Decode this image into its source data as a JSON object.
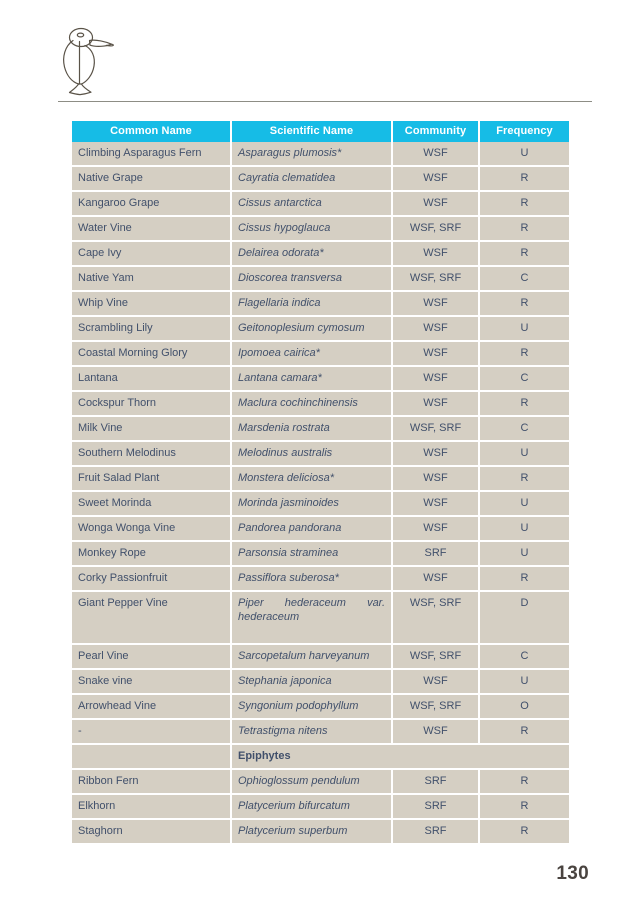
{
  "document": {
    "page_number": "130",
    "logo_name": "bird-logo"
  },
  "table": {
    "columns": [
      {
        "key": "common",
        "label": "Common Name"
      },
      {
        "key": "scientific",
        "label": "Scientific Name"
      },
      {
        "key": "community",
        "label": "Community"
      },
      {
        "key": "frequency",
        "label": "Frequency"
      }
    ],
    "header_bg": "#16bce6",
    "row_bg": "#d5cfc3",
    "group_bg": "#6b6142",
    "text_color": "#41506b",
    "rows": [
      {
        "type": "data",
        "common": "Climbing Asparagus Fern",
        "scientific": "Asparagus plumosis*",
        "community": "WSF",
        "frequency": "U"
      },
      {
        "type": "data",
        "common": "Native Grape",
        "scientific": "Cayratia clematidea",
        "community": "WSF",
        "frequency": "R"
      },
      {
        "type": "data",
        "common": "Kangaroo Grape",
        "scientific": "Cissus antarctica",
        "community": "WSF",
        "frequency": "R"
      },
      {
        "type": "data",
        "common": "Water Vine",
        "scientific": "Cissus hypoglauca",
        "community": "WSF, SRF",
        "frequency": "R"
      },
      {
        "type": "data",
        "common": "Cape Ivy",
        "scientific": "Delairea odorata*",
        "community": "WSF",
        "frequency": "R"
      },
      {
        "type": "data",
        "common": "Native Yam",
        "scientific": "Dioscorea transversa",
        "community": "WSF, SRF",
        "frequency": "C"
      },
      {
        "type": "data",
        "common": "Whip Vine",
        "scientific": "Flagellaria indica",
        "community": "WSF",
        "frequency": "R"
      },
      {
        "type": "data",
        "common": "Scrambling Lily",
        "scientific": "Geitonoplesium cymosum",
        "community": "WSF",
        "frequency": "U"
      },
      {
        "type": "data",
        "common": "Coastal Morning Glory",
        "scientific": "Ipomoea cairica*",
        "community": "WSF",
        "frequency": "R"
      },
      {
        "type": "data",
        "common": "Lantana",
        "scientific": "Lantana camara*",
        "community": "WSF",
        "frequency": "C"
      },
      {
        "type": "data",
        "common": "Cockspur Thorn",
        "scientific": "Maclura cochinchinensis",
        "community": "WSF",
        "frequency": "R"
      },
      {
        "type": "data",
        "common": "Milk Vine",
        "scientific": "Marsdenia rostrata",
        "community": "WSF, SRF",
        "frequency": "C"
      },
      {
        "type": "data",
        "common": "Southern Melodinus",
        "scientific": "Melodinus australis",
        "community": "WSF",
        "frequency": "U"
      },
      {
        "type": "data",
        "common": "Fruit Salad Plant",
        "scientific": "Monstera deliciosa*",
        "community": "WSF",
        "frequency": "R"
      },
      {
        "type": "data",
        "common": "Sweet Morinda",
        "scientific": "Morinda jasminoides",
        "community": "WSF",
        "frequency": "U"
      },
      {
        "type": "data",
        "common": "Wonga Wonga Vine",
        "scientific": "Pandorea pandorana",
        "community": "WSF",
        "frequency": "U"
      },
      {
        "type": "data",
        "common": "Monkey Rope",
        "scientific": "Parsonsia straminea",
        "community": "SRF",
        "frequency": "U"
      },
      {
        "type": "data",
        "common": "Corky Passionfruit",
        "scientific": "Passiflora suberosa*",
        "community": "WSF",
        "frequency": "R"
      },
      {
        "type": "data",
        "common": "Giant Pepper Vine",
        "scientific": "Piper hederaceum var. hederaceum",
        "community": "WSF, SRF",
        "frequency": "D",
        "justify": true
      },
      {
        "type": "data",
        "common": "Pearl Vine",
        "scientific": "Sarcopetalum harveyanum",
        "community": "WSF, SRF",
        "frequency": "C"
      },
      {
        "type": "data",
        "common": "Snake vine",
        "scientific": "Stephania japonica",
        "community": "WSF",
        "frequency": "U"
      },
      {
        "type": "data",
        "common": "Arrowhead Vine",
        "scientific": "Syngonium podophyllum",
        "community": "WSF, SRF",
        "frequency": "O"
      },
      {
        "type": "data",
        "common": "-",
        "scientific": "Tetrastigma nitens",
        "community": "WSF",
        "frequency": "R"
      },
      {
        "type": "group",
        "label": "Epiphytes"
      },
      {
        "type": "data",
        "common": "Ribbon Fern",
        "scientific": "Ophioglossum pendulum",
        "community": "SRF",
        "frequency": "R"
      },
      {
        "type": "data",
        "common": "Elkhorn",
        "scientific": "Platycerium bifurcatum",
        "community": "SRF",
        "frequency": "R"
      },
      {
        "type": "data",
        "common": "Staghorn",
        "scientific": "Platycerium superbum",
        "community": "SRF",
        "frequency": "R"
      }
    ]
  }
}
